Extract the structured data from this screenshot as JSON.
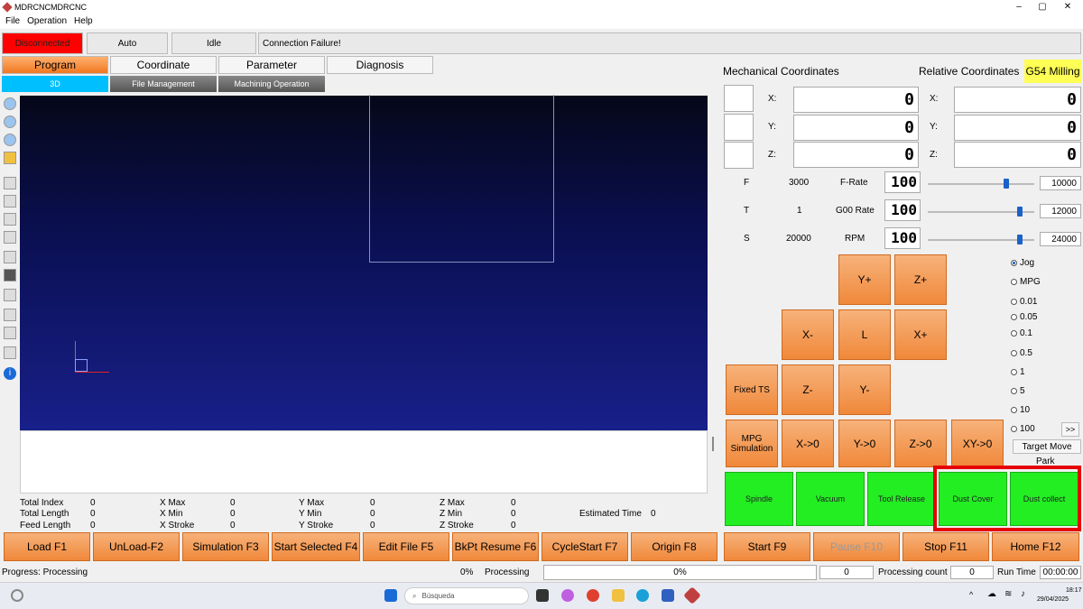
{
  "window": {
    "title": "MDRCNCMDRCNC",
    "min": "–",
    "max": "▢",
    "close": "✕"
  },
  "menu": [
    "File",
    "Operation",
    "Help"
  ],
  "status": {
    "connection": "Disconnected",
    "mode": "Auto",
    "state": "Idle",
    "message": "Connection Failure!"
  },
  "tabs": [
    "Program",
    "Coordinate",
    "Parameter",
    "Diagnosis"
  ],
  "subtabs": [
    "3D",
    "File Management",
    "Machining Operation"
  ],
  "coords": {
    "mech_title": "Mechanical Coordinates",
    "rel_title": "Relative Coordinates",
    "wcs": "G54 Milling",
    "axes": [
      "X:",
      "Y:",
      "Z:"
    ],
    "mech_values": [
      "0",
      "0",
      "0"
    ],
    "rel_values": [
      "0",
      "0",
      "0"
    ]
  },
  "rates": [
    {
      "label": "F",
      "value": "3000",
      "name": "F-Rate",
      "pct": "100",
      "max": "10000",
      "level": 0.75
    },
    {
      "label": "T",
      "value": "1",
      "name": "G00 Rate",
      "pct": "100",
      "max": "12000",
      "level": 0.88
    },
    {
      "label": "S",
      "value": "20000",
      "name": "RPM",
      "pct": "100",
      "max": "24000",
      "level": 0.88
    }
  ],
  "jog": {
    "yplus": "Y+",
    "zplus": "Z+",
    "xminus": "X-",
    "l": "L",
    "xplus": "X+",
    "fixed_ts": "Fixed TS",
    "zminus": "Z-",
    "yminus": "Y-",
    "mpg_sim": "MPG Simulation",
    "x0": "X->0",
    "y0": "Y->0",
    "z0": "Z->0",
    "xy0": "XY->0"
  },
  "modes": {
    "jog": "Jog",
    "mpg": "MPG",
    "steps": [
      "0.01",
      "0.05",
      "0.1",
      "0.5",
      "1",
      "5",
      "10",
      "100"
    ],
    "more": ">>",
    "target": "Target Move",
    "park": "Park"
  },
  "outputs": [
    "Spindle",
    "Vacuum",
    "Tool Release",
    "Dust Cover",
    "Dust collect"
  ],
  "info": {
    "total_index": "Total Index",
    "total_length": "Total Length",
    "feed_length": "Feed Length",
    "xmax": "X Max",
    "xmin": "X Min",
    "xstroke": "X Stroke",
    "ymax": "Y Max",
    "ymin": "Y Min",
    "ystroke": "Y Stroke",
    "zmax": "Z Max",
    "zmin": "Z Min",
    "zstroke": "Z Stroke",
    "zero": "0",
    "est_time": "Estimated Time",
    "est_value": "0"
  },
  "buttons": [
    "Load F1",
    "UnLoad-F2",
    "Simulation F3",
    "Start Selected F4",
    "Edit File F5",
    "BkPt Resume F6",
    "CycleStart F7",
    "Origin F8",
    "Start F9",
    "Pause F10",
    "Stop F11",
    "Home F12"
  ],
  "progress": {
    "label": "Progress: Processing",
    "pct1": "0%",
    "processing": "Processing",
    "pct2": "0%",
    "count_val": "0",
    "count_label": "Processing count",
    "count2": "0",
    "runtime_label": "Run Time",
    "runtime": "00:00:00"
  },
  "taskbar": {
    "search": "Búsqueda",
    "time": "18:17",
    "date": "29/04/2025"
  },
  "colors": {
    "accent": "#f0883a",
    "green": "#22ee22",
    "highlight": "#e60000",
    "disconnected": "#ff0000",
    "wcs_bg": "#ffff55",
    "subtab_active": "#00bfff"
  }
}
